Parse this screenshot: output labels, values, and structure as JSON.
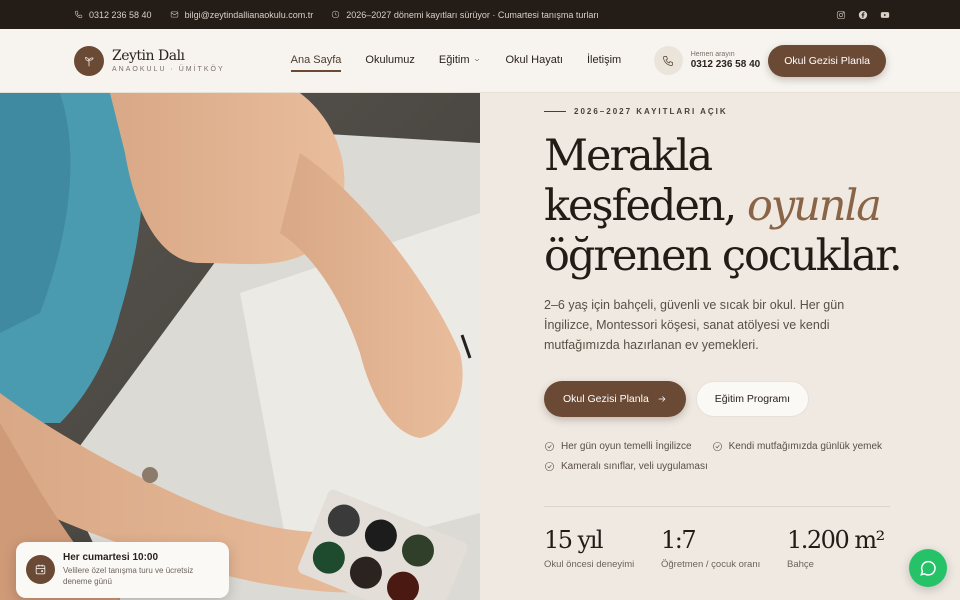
{
  "topbar": {
    "phone": "0312 236 58 40",
    "email": "bilgi@zeytindallianaokulu.com.tr",
    "notice": "2026–2027 dönemi kayıtları sürüyor · Cumartesi tanışma turları",
    "social": [
      "instagram-icon",
      "facebook-icon",
      "youtube-icon"
    ]
  },
  "header": {
    "brand": "Zeytin Dalı",
    "subtitle": "ANAOKULU · ÜMİTKÖY",
    "nav": [
      {
        "label": "Ana Sayfa",
        "active": true
      },
      {
        "label": "Okulumuz"
      },
      {
        "label": "Eğitim",
        "dropdown": true
      },
      {
        "label": "Okul Hayatı"
      },
      {
        "label": "İletişim"
      }
    ],
    "call_small": "Hemen arayın",
    "call_number": "0312 236 58 40",
    "cta": "Okul Gezisi Planla"
  },
  "hero": {
    "eyebrow": "2026–2027 KAYITLARI AÇIK",
    "headline_line1": "Merakla",
    "headline_line2a": "keşfeden, ",
    "headline_accent": "oyunla",
    "headline_line3": "öğrenen çocuklar.",
    "lead": "2–6 yaş için bahçeli, güvenli ve sıcak bir okul. Her gün İngilizce, Montessori köşesi, sanat atölyesi ve kendi mutfağımızda hazırlanan ev yemekleri.",
    "primary_cta": "Okul Gezisi Planla",
    "secondary_cta": "Eğitim Programı",
    "features": [
      "Her gün oyun temelli İngilizce",
      "Kendi mutfağımızda günlük yemek",
      "Kameralı sınıflar, veli uygulaması"
    ],
    "stats": [
      {
        "value": "15 yıl",
        "label": "Okul öncesi deneyimi"
      },
      {
        "value": "1:7",
        "label": "Öğretmen / çocuk oranı"
      },
      {
        "value": "1.200 m²",
        "label": "Bahçe"
      }
    ]
  },
  "float_card": {
    "title": "Her cumartesi 10:00",
    "text": "Velilere özel tanışma turu ve ücretsiz deneme günü"
  },
  "colors": {
    "brand": "#6b4a35",
    "topbar": "#241c16",
    "accent_text": "#8a6446",
    "whatsapp": "#25c267"
  }
}
